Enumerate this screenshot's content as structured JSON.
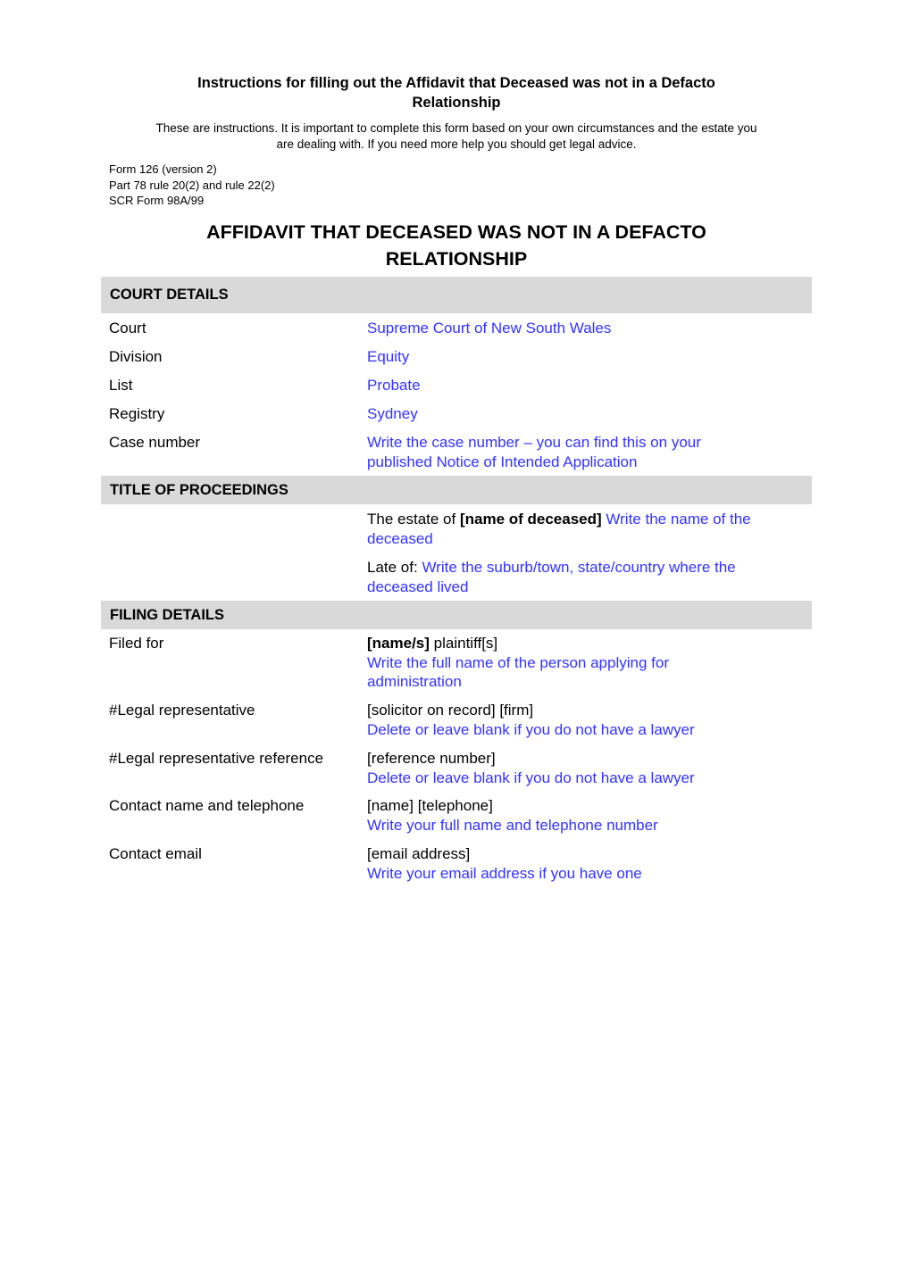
{
  "instructions": {
    "title_line1": "Instructions for filling out the Affidavit that Deceased was not in a Defacto",
    "title_line2": "Relationship",
    "note_line1": "These are instructions. It is important to complete this form based on your own circumstances and the estate you",
    "note_line2": "are dealing with. If you need more help you should get legal advice."
  },
  "form_meta": {
    "form_number": "Form 126 (version 2)",
    "rule": "Part 78 rule 20(2) and rule 22(2)",
    "scr_form": "SCR Form 98A/99"
  },
  "main_title": {
    "line1": "AFFIDAVIT THAT DECEASED WAS NOT IN A DEFACTO",
    "line2": "RELATIONSHIP"
  },
  "colors": {
    "instruction_text": "#3333ff",
    "section_header_bg": "#d9d9d9"
  },
  "court_details": {
    "heading": "COURT DETAILS",
    "rows": [
      {
        "label": "Court",
        "value": "Supreme Court of New South Wales"
      },
      {
        "label": "Division",
        "value": "Equity"
      },
      {
        "label": "List",
        "value": "Probate"
      },
      {
        "label": "Registry",
        "value": "Sydney"
      },
      {
        "label": "Case number",
        "value_line1": "Write the case number – you can find this on your",
        "value_line2": "published Notice of Intended Application"
      }
    ]
  },
  "title_of_proceedings": {
    "heading": "TITLE OF PROCEEDINGS",
    "estate_prefix": "The estate of ",
    "estate_placeholder": "[name of deceased]",
    "estate_instruction_line1": " Write the name of the",
    "estate_instruction_line2": "deceased",
    "late_of_prefix": "Late of: ",
    "late_of_instruction_line1": "Write the suburb/town, state/country where the",
    "late_of_instruction_line2": "deceased lived"
  },
  "filing_details": {
    "heading": "FILING DETAILS",
    "rows": [
      {
        "label": "Filed for",
        "placeholder_bold": "[name/s]",
        "placeholder_rest": " plaintiff[s]",
        "instruction_line1": "Write the full name of the person applying for",
        "instruction_line2": "administration"
      },
      {
        "label": "#Legal representative",
        "placeholder": "[solicitor on record] [firm]",
        "instruction": "Delete or leave blank if you do not have a lawyer"
      },
      {
        "label": "#Legal representative reference",
        "placeholder": "[reference number]",
        "instruction": "Delete or leave blank if you do not have a lawyer"
      },
      {
        "label": "Contact name and telephone",
        "placeholder": "[name] [telephone]",
        "instruction": "Write your full name and telephone number"
      },
      {
        "label": "Contact email",
        "placeholder": "[email address]",
        "instruction": "Write your email address if you have one"
      }
    ]
  }
}
